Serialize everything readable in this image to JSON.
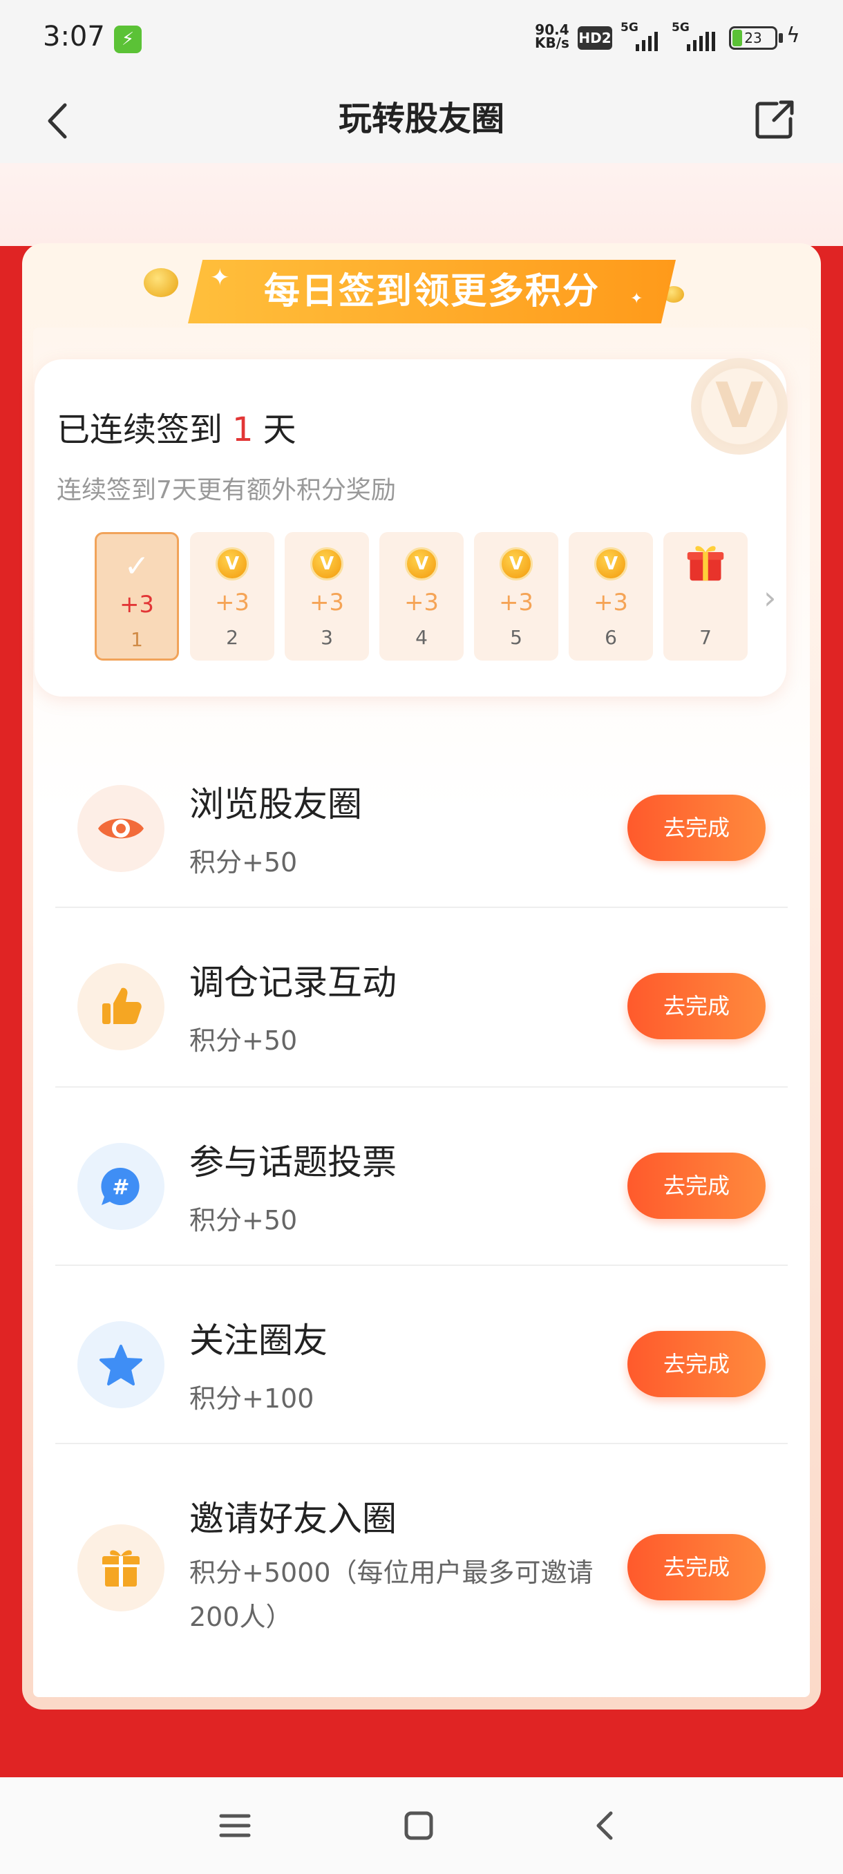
{
  "status_bar": {
    "time": "3:07",
    "net_speed_value": "90.4",
    "net_speed_unit": "KB/s",
    "hd_badge": "HD2",
    "signal_1_label": "5G",
    "signal_2_label": "5G",
    "battery_level": "23"
  },
  "nav": {
    "title": "玩转股友圈"
  },
  "banner": {
    "ribbon_text": "每日签到领更多积分"
  },
  "checkin": {
    "title_prefix": "已连续签到",
    "days": "1",
    "title_suffix": "天",
    "subtitle": "连续签到7天更有额外积分奖励",
    "coin_letter": "V",
    "days_list": [
      {
        "reward": "+3",
        "day": "1",
        "status": "done"
      },
      {
        "reward": "+3",
        "day": "2",
        "status": "pending"
      },
      {
        "reward": "+3",
        "day": "3",
        "status": "pending"
      },
      {
        "reward": "+3",
        "day": "4",
        "status": "pending"
      },
      {
        "reward": "+3",
        "day": "5",
        "status": "pending"
      },
      {
        "reward": "+3",
        "day": "6",
        "status": "pending"
      },
      {
        "reward": "",
        "day": "7",
        "status": "gift"
      }
    ]
  },
  "tasks": [
    {
      "title": "浏览股友圈",
      "points": "积分+50",
      "button": "去完成",
      "icon": "eye-icon",
      "icon_bg": "#fdeee6",
      "icon_color": "#f26b3a"
    },
    {
      "title": "调仓记录互动",
      "points": "积分+50",
      "button": "去完成",
      "icon": "thumbs-up-icon",
      "icon_bg": "#fdf0e3",
      "icon_color": "#f5a623"
    },
    {
      "title": "参与话题投票",
      "points": "积分+50",
      "button": "去完成",
      "icon": "hashtag-chat-icon",
      "icon_bg": "#eaf3fd",
      "icon_color": "#3f8ef5"
    },
    {
      "title": "关注圈友",
      "points": "积分+100",
      "button": "去完成",
      "icon": "star-icon",
      "icon_bg": "#eaf3fd",
      "icon_color": "#3f8ef5"
    },
    {
      "title": "邀请好友入圈",
      "points": "积分+5000（每位用户最多可邀请200人）",
      "button": "去完成",
      "icon": "gift-icon",
      "icon_bg": "#fdf0e3",
      "icon_color": "#f5a623"
    }
  ],
  "colors": {
    "page_red": "#e02424",
    "accent_orange": "#ff6a30",
    "highlight_red": "#e23636"
  }
}
